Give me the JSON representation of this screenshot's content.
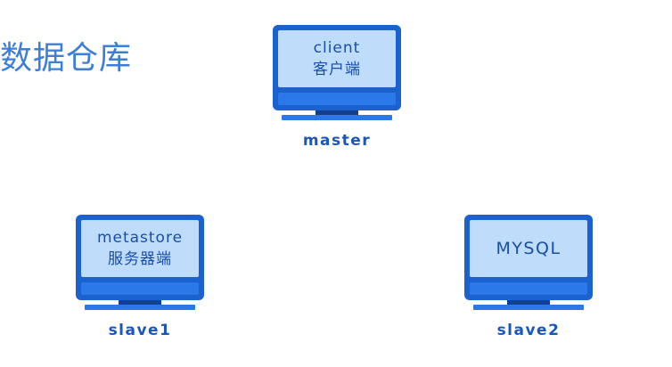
{
  "title": "数据仓库",
  "nodes": {
    "master": {
      "screen_line1": "client",
      "screen_line2": "客户端",
      "label": "master"
    },
    "slave1": {
      "screen_line1": "metastore",
      "screen_line2": "服务器端",
      "label": "slave1"
    },
    "slave2": {
      "screen_line1": "MYSQL",
      "label": "slave2"
    }
  },
  "colors": {
    "monitor_frame": "#1c61d0",
    "screen": "#bfddfb",
    "screen_text": "#174ea8",
    "label_text": "#1a57b8",
    "title_text": "#3d7fd8"
  },
  "icons": [
    "monitor-icon"
  ]
}
